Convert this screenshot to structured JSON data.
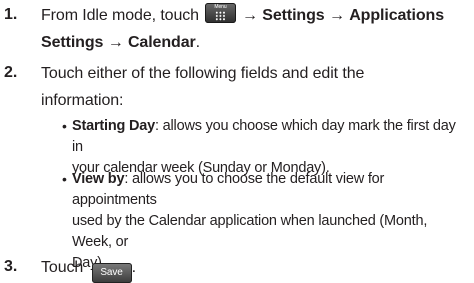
{
  "steps": [
    {
      "number": "1.",
      "intro": "From Idle mode, touch",
      "menu_key_label": "Menu",
      "path": [
        {
          "sep": "→",
          "label": "Settings"
        },
        {
          "sep": "→",
          "label": "Applications Settings"
        },
        {
          "sep": "→",
          "label": "Calendar"
        }
      ],
      "end": "."
    },
    {
      "number": "2.",
      "line1": "Touch either of the following fields and edit the",
      "line2": "information:"
    },
    {
      "number": "3.",
      "text": "Touch",
      "button_label": "Save",
      "end": "."
    }
  ],
  "bullets": [
    {
      "term": "Starting Day",
      "line1": ": allows you choose which day mark the first day in",
      "line2": "your calendar week (Sunday or Monday)."
    },
    {
      "term": "View by",
      "line1": ": allows you to choose the default view for appointments",
      "line2": "used by the Calendar application when launched (Month, Week, or",
      "line3": "Day)."
    }
  ]
}
